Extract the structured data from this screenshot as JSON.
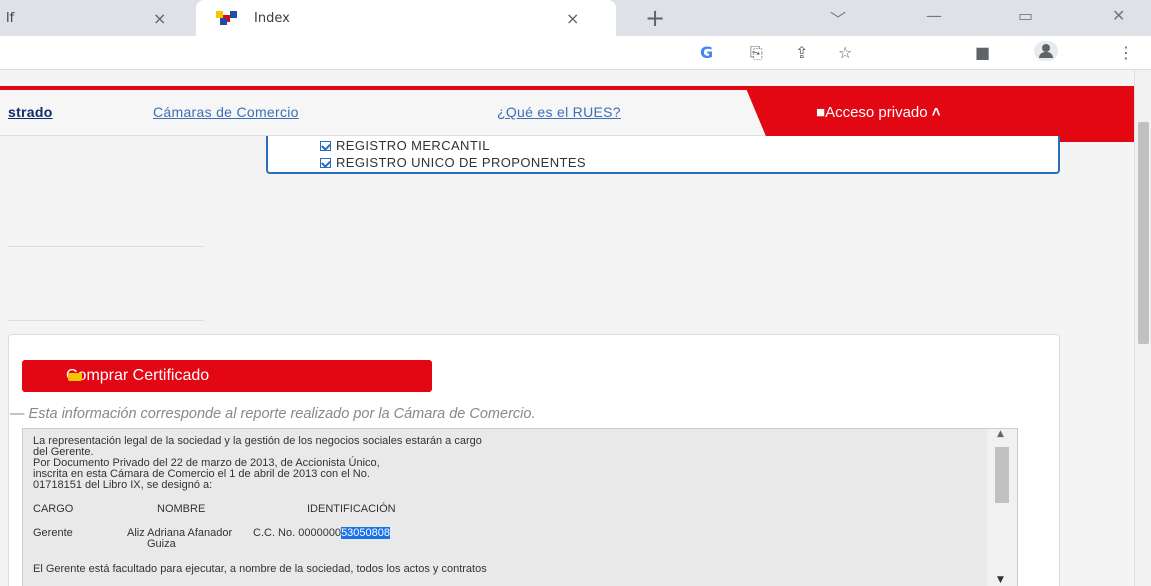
{
  "browser": {
    "prev_tab_title": "lf",
    "active_tab_title": "Index",
    "close_glyph": "×",
    "new_tab_glyph": "+",
    "toolbar_icons": [
      "google-icon",
      "translate-icon",
      "share-icon",
      "bookmark-star-icon",
      "sidepanel-icon",
      "profile-icon",
      "menu-icon"
    ]
  },
  "nav": {
    "registrado": "strado",
    "camaras": "Cámaras de Comercio",
    "rues": "¿Qué es el RUES?",
    "access": "Acceso privado"
  },
  "registros": [
    "REGISTRO MERCANTIL",
    "REGISTRO UNICO DE PROPONENTES"
  ],
  "buy_button": "Comprar Certificado",
  "info_note": "— Esta información corresponde al reporte realizado por la Cámara de Comercio.",
  "certificate": {
    "l1": "La representación legal de la sociedad y la gestión de los negocios sociales estarán a cargo",
    "l2": "del Gerente.",
    "l3": "Por  Documento  Privado  del 22 de marzo de 2013, de Accionista Único,",
    "l4": "inscrita  en  esta Cámara de Comercio el 1 de abril de 2013 con el No.",
    "l5": "01718151 del Libro IX, se designó a:",
    "h_cargo": "CARGO",
    "h_nombre": "NOMBRE",
    "h_id": "IDENTIFICACIÓN",
    "r_cargo": "Gerente",
    "r_nombre": "Aliz  Adriana  Afanador",
    "r_id_prefix": "C.C. No. 0000000",
    "r_id_selected": "53050808",
    "r_nombre2": "Guiza",
    "l6": "El Gerente está facultado para ejecutar, a nombre de la sociedad, todos los actos y contratos"
  },
  "colors": {
    "brand_red": "#e30613",
    "nav_blue": "#3d6fb5",
    "selection": "#1a73e8"
  }
}
